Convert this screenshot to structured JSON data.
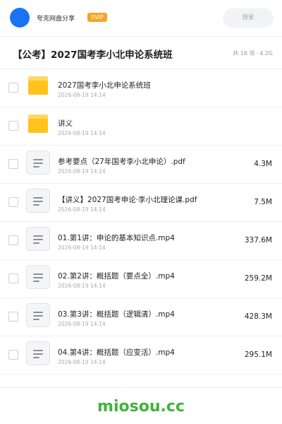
{
  "header": {
    "app_name": "夸克网盘分享",
    "badge": "SVIP",
    "search_placeholder": "搜索",
    "avatar_color": "#1a73f5"
  },
  "title_bar": {
    "title": "【公考】2027国考李小北申论系统班",
    "item_count": "共 16 项",
    "total_size": "4.2G"
  },
  "files": [
    {
      "type": "folder",
      "icon": "folder-icon",
      "name": "2027国考李小北申论系统班",
      "date": "2026-08-19 14:14",
      "size": ""
    },
    {
      "type": "folder",
      "icon": "folder-icon",
      "name": "讲义",
      "date": "2026-08-19 14:14",
      "size": ""
    },
    {
      "type": "file",
      "icon": "document-icon",
      "name": "参考要点（27年国考李小北申论）.pdf",
      "date": "2026-08-19 14:14",
      "size": "4.3M"
    },
    {
      "type": "file",
      "icon": "document-icon",
      "name": "【讲义】2027国考申论·李小北理论课.pdf",
      "date": "2026-08-19 14:14",
      "size": "7.5M"
    },
    {
      "type": "file",
      "icon": "document-icon",
      "name": "01.第1讲：申论的基本知识点.mp4",
      "date": "2026-08-19 14:14",
      "size": "337.6M"
    },
    {
      "type": "file",
      "icon": "document-icon",
      "name": "02.第2讲：概括题（要点全）.mp4",
      "date": "2026-08-19 14:14",
      "size": "259.2M"
    },
    {
      "type": "file",
      "icon": "document-icon",
      "name": "03.第3讲：概括题（逻辑清）.mp4",
      "date": "2026-08-19 14:14",
      "size": "428.3M"
    },
    {
      "type": "file",
      "icon": "document-icon",
      "name": "04.第4讲：概括题（应变活）.mp4",
      "date": "2026-08-19 14:14",
      "size": "295.1M"
    }
  ],
  "footer": {
    "watermark": "miosou.cc",
    "watermark_color": "#41b23c"
  }
}
